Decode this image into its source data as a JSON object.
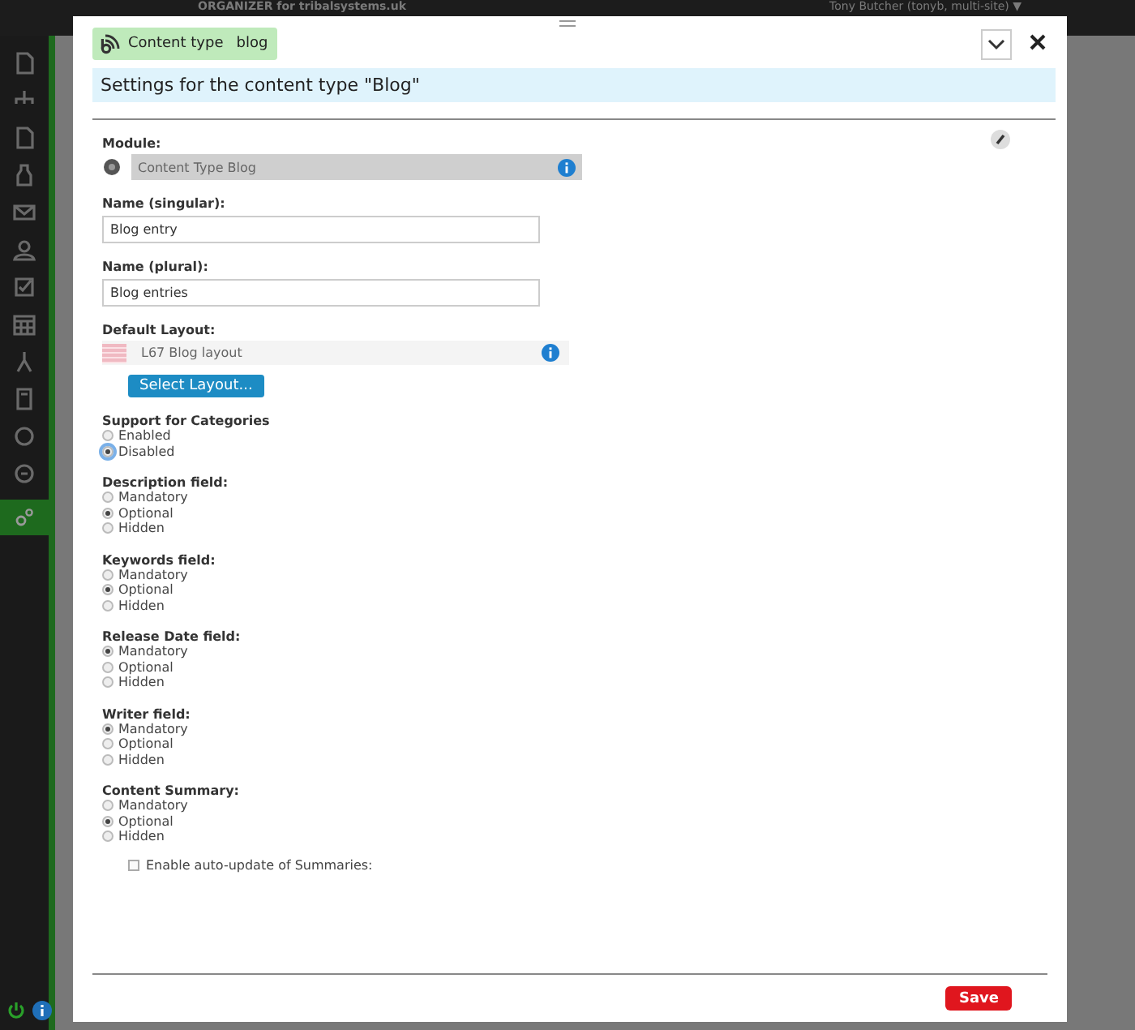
{
  "background": {
    "app_title": "ORGANIZER for tribalsystems.uk",
    "user": "Tony Butcher (tonyb, multi-site) ▼"
  },
  "dialog": {
    "tag": {
      "label": "Content type",
      "value": "blog"
    },
    "heading": "Settings for the content type \"Blog\"",
    "module": {
      "label": "Module:",
      "value": "Content Type Blog"
    },
    "fields": [
      {
        "label": "Name (singular):",
        "value": "Blog entry"
      },
      {
        "label": "Name (plural):",
        "value": "Blog entries"
      }
    ],
    "layout": {
      "label": "Default Layout:",
      "value": "L67 Blog layout",
      "button": "Select Layout..."
    },
    "radio_groups": [
      {
        "label": "Support for Categories",
        "options": [
          {
            "label": "Enabled",
            "selected": false,
            "focused": false
          },
          {
            "label": "Disabled",
            "selected": true,
            "focused": true
          }
        ]
      },
      {
        "label": "Description field:",
        "options": [
          {
            "label": "Mandatory",
            "selected": false
          },
          {
            "label": "Optional",
            "selected": true
          },
          {
            "label": "Hidden",
            "selected": false
          }
        ]
      },
      {
        "label": "Keywords field:",
        "options": [
          {
            "label": "Mandatory",
            "selected": false
          },
          {
            "label": "Optional",
            "selected": true
          },
          {
            "label": "Hidden",
            "selected": false
          }
        ]
      },
      {
        "label": "Release Date field:",
        "options": [
          {
            "label": "Mandatory",
            "selected": true
          },
          {
            "label": "Optional",
            "selected": false
          },
          {
            "label": "Hidden",
            "selected": false
          }
        ]
      },
      {
        "label": "Writer field:",
        "options": [
          {
            "label": "Mandatory",
            "selected": true
          },
          {
            "label": "Optional",
            "selected": false
          },
          {
            "label": "Hidden",
            "selected": false
          }
        ]
      },
      {
        "label": "Content Summary:",
        "options": [
          {
            "label": "Mandatory",
            "selected": false
          },
          {
            "label": "Optional",
            "selected": true
          },
          {
            "label": "Hidden",
            "selected": false
          }
        ]
      }
    ],
    "auto_update": {
      "label": "Enable auto-update of Summaries:",
      "checked": false
    },
    "save": "Save"
  }
}
